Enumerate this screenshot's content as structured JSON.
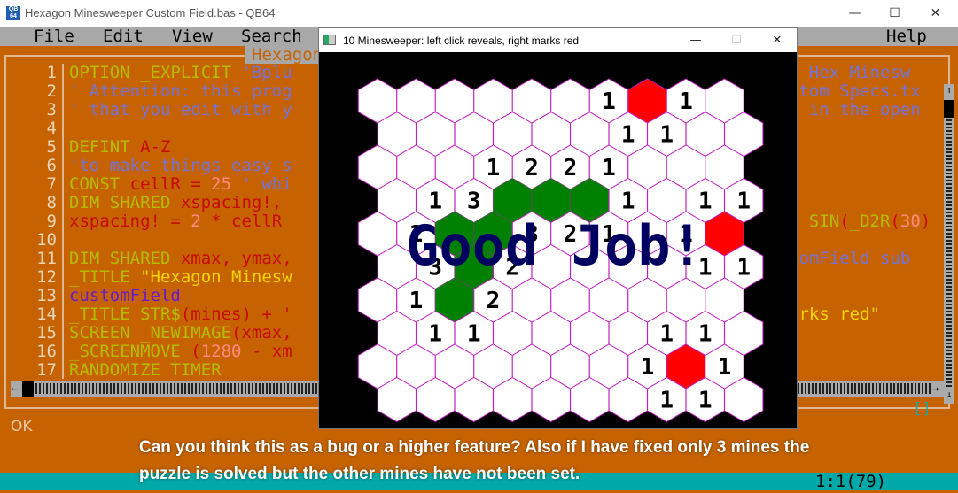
{
  "ide": {
    "title": "Hexagon Minesweeper Custom Field.bas - QB64",
    "logo": "QB64",
    "window_buttons": {
      "minimize": "—",
      "maximize": "☐",
      "close": "✕"
    },
    "menu": [
      "File",
      "Edit",
      "View",
      "Search",
      "Help"
    ],
    "tab_name": "Hexagon",
    "line_numbers": [
      "1",
      "2",
      "3",
      "4",
      "5",
      "6",
      "7",
      "8",
      "9",
      "10",
      "11",
      "12",
      "13",
      "14",
      "15",
      "16",
      "17"
    ],
    "code_left": [
      [
        [
          "kw",
          "OPTION _EXPLICIT "
        ],
        [
          "cm",
          "'Bplu"
        ]
      ],
      [
        [
          "cm",
          "' Attention: this prog"
        ]
      ],
      [
        [
          "cm",
          "' that you edit with y"
        ]
      ],
      [],
      [
        [
          "kw",
          "DEFINT "
        ],
        [
          "vr",
          "A-Z"
        ]
      ],
      [
        [
          "cm",
          "'to make things easy s"
        ]
      ],
      [
        [
          "kw",
          "CONST "
        ],
        [
          "vr",
          "cellR = "
        ],
        [
          "nm",
          "25"
        ],
        [
          "cm",
          " ' whi"
        ]
      ],
      [
        [
          "kw",
          "DIM SHARED "
        ],
        [
          "vr",
          "xspacing!,"
        ]
      ],
      [
        [
          "vr",
          "xspacing! = "
        ],
        [
          "nm",
          "2"
        ],
        [
          "vr",
          " * cellR"
        ]
      ],
      [],
      [
        [
          "kw",
          "DIM SHARED "
        ],
        [
          "vr",
          "xmax, ymax,"
        ]
      ],
      [
        [
          "kw",
          "_TITLE "
        ],
        [
          "st",
          "\"Hexagon Minesw"
        ]
      ],
      [
        [
          "fn",
          "customField"
        ]
      ],
      [
        [
          "kw",
          "_TITLE STR$"
        ],
        [
          "vr",
          "(mines) + '"
        ]
      ],
      [
        [
          "kw",
          "SCREEN _NEWIMAGE"
        ],
        [
          "vr",
          "(xmax,"
        ]
      ],
      [
        [
          "kw",
          "_SCREENMOVE "
        ],
        [
          "vr",
          "("
        ],
        [
          "nm",
          "1280"
        ],
        [
          "vr",
          " - xm"
        ]
      ],
      [
        [
          "kw",
          "RANDOMIZE TIMER"
        ]
      ]
    ],
    "code_right": [
      [
        [
          "cm",
          "f Hex Minesw"
        ]
      ],
      [
        [
          "cm",
          "stom Specs.tx"
        ]
      ],
      [
        [
          "cm",
          "n in the open"
        ]
      ],
      [],
      [],
      [],
      [],
      [],
      [
        [
          "kw",
          "  SIN"
        ],
        [
          "vr",
          "("
        ],
        [
          "kw",
          "_D2R"
        ],
        [
          "vr",
          "("
        ],
        [
          "nm",
          "30"
        ],
        [
          "vr",
          ")"
        ]
      ],
      [],
      [
        [
          "cm",
          "tomField sub"
        ]
      ],
      [],
      [],
      [
        [
          "st",
          "arks red\""
        ]
      ],
      [],
      [],
      []
    ],
    "status_message": "OK",
    "cursor_position": "1:1(79)",
    "brackets": "[]",
    "colors": {
      "background": "#c66300",
      "menu": "#a8a8a8",
      "status": "#00a8a8"
    }
  },
  "game": {
    "title": "10 Minesweeper: left click reveals, right marks red",
    "buttons": {
      "minimize": "—",
      "maximize": "☐",
      "close": "✕"
    },
    "message": "Good Job!",
    "legend": {
      "G": "revealed mine (green)",
      "R": "marked red"
    },
    "colors": {
      "cell": "#ffffff",
      "border": "#c020c0",
      "mine": "#008000",
      "marked": "#ff0000",
      "message": "#000060"
    },
    "grid": [
      [
        "",
        "",
        "",
        "",
        "",
        "",
        "1",
        "R",
        "1",
        ""
      ],
      [
        "",
        "",
        "",
        "",
        "",
        "",
        "1",
        "1",
        "",
        ""
      ],
      [
        "",
        "",
        "",
        "1",
        "2",
        "2",
        "1",
        "",
        "",
        ""
      ],
      [
        "",
        "1",
        "3",
        "G",
        "G",
        "G",
        "1",
        "",
        "1",
        "1"
      ],
      [
        "",
        "1",
        "G",
        "G",
        "3",
        "2",
        "1",
        "",
        "1",
        "R"
      ],
      [
        "",
        "3",
        "G",
        "2",
        "",
        "",
        "",
        "",
        "1",
        "1"
      ],
      [
        "",
        "1",
        "G",
        "2",
        "",
        "",
        "",
        "",
        "",
        ""
      ],
      [
        "",
        "1",
        "1",
        "",
        "",
        "",
        "",
        "1",
        "1",
        ""
      ],
      [
        "",
        "",
        "",
        "",
        "",
        "",
        "",
        "1",
        "R",
        "1"
      ],
      [
        "",
        "",
        "",
        "",
        "",
        "",
        "",
        "1",
        "1",
        ""
      ]
    ]
  },
  "caption": {
    "line1": "Can you think this as a bug or a higher feature? Also if I have fixed only 3 mines the",
    "line2": "puzzle is solved but the other mines have not been set."
  }
}
